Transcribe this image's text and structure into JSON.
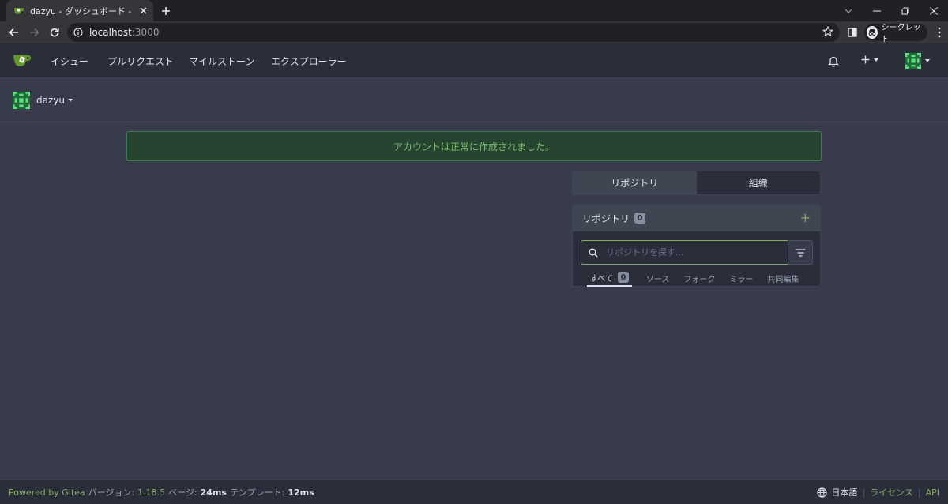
{
  "browser": {
    "tab_title": "dazyu - ダッシュボード - Gitea: Git w",
    "url_host": "localhost",
    "url_port": ":3000",
    "profile_label": "シークレット"
  },
  "nav": {
    "items": [
      "イシュー",
      "プルリクエスト",
      "マイルストーン",
      "エクスプローラー"
    ]
  },
  "context_user": {
    "name": "dazyu"
  },
  "flash": {
    "message": "アカウントは正常に作成されました。"
  },
  "dashboard": {
    "switch": {
      "repos": "リポジトリ",
      "orgs": "組織"
    },
    "repo_list": {
      "title": "リポジトリ",
      "count": "0",
      "add_symbol": "+",
      "search_placeholder": "リポジトリを探す...",
      "tabs": [
        {
          "label": "すべて",
          "count": "0"
        },
        {
          "label": "ソース"
        },
        {
          "label": "フォーク"
        },
        {
          "label": "ミラー"
        },
        {
          "label": "共同編集"
        }
      ]
    }
  },
  "footer": {
    "powered_by": "Powered by Gitea",
    "version_label": "バージョン:",
    "version": "1.18.5",
    "page_label": "ページ:",
    "page_time": "24ms",
    "template_label": "テンプレート:",
    "template_time": "12ms",
    "language": "日本語",
    "license": "ライセンス",
    "api": "API"
  },
  "colors": {
    "accent": "#87ab63",
    "background": "#383c4a",
    "navbar": "#2a2e3a",
    "flash_bg": "#264430"
  },
  "icons": [
    "gitea-logo",
    "bell-icon",
    "plus-icon",
    "search-icon",
    "filter-icon",
    "globe-icon",
    "star-icon",
    "incognito-icon"
  ]
}
